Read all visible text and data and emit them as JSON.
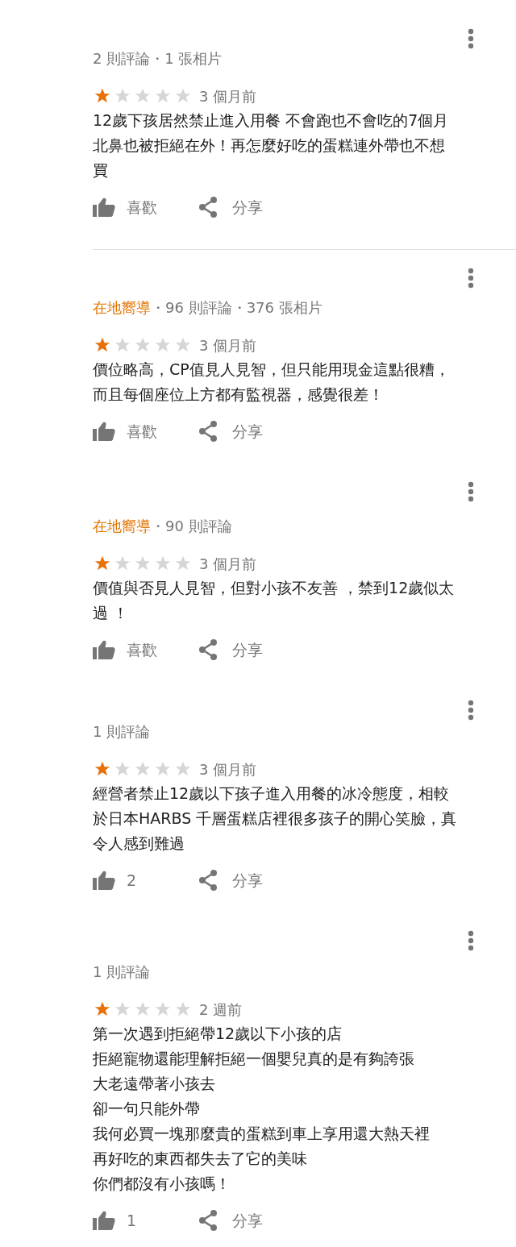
{
  "reviews": [
    {
      "stats": "2 則評論・1 張相片",
      "stars": 1,
      "time": "3 個月前",
      "lines": [
        "12歲下孩居然禁止進入用餐 不會跑也不會吃的7個月",
        "北鼻也被拒絕在外！再怎麼好吃的蛋糕連外帶也不想",
        "買"
      ],
      "like": "喜歡",
      "share": "分享",
      "divider_below": true
    },
    {
      "badge": "在地嚮導",
      "stats": "・96 則評論・376 張相片",
      "stars": 1,
      "time": "3 個月前",
      "lines": [
        "價位略高，CP值見人見智，但只能用現金這點很糟，",
        "而且每個座位上方都有監視器，感覺很差！"
      ],
      "like": "喜歡",
      "share": "分享",
      "divider_below": false
    },
    {
      "badge": "在地嚮導",
      "stats": "・90 則評論",
      "stars": 1,
      "time": "3 個月前",
      "lines": [
        "價值與否見人見智，但對小孩不友善 ，禁到12歲似太",
        "過 ！"
      ],
      "like": "喜歡",
      "share": "分享",
      "divider_below": false
    },
    {
      "stats": "1 則評論",
      "stars": 1,
      "time": "3 個月前",
      "lines": [
        "經營者禁止12歲以下孩子進入用餐的冰冷態度，相較",
        "於日本HARBS 千層蛋糕店裡很多孩子的開心笑臉，真",
        "令人感到難過"
      ],
      "like": "2",
      "share": "分享",
      "divider_below": false
    },
    {
      "stats": "1 則評論",
      "stars": 1,
      "time": "2 週前",
      "lines": [
        "第一次遇到拒絕帶12歲以下小孩的店",
        "拒絕寵物還能理解拒絕一個嬰兒真的是有夠誇張",
        "大老遠帶著小孩去",
        "卻一句只能外帶",
        "我何必買一塊那麼貴的蛋糕到車上享用還大熱天裡",
        "再好吃的東西都失去了它的美味",
        "你們都沒有小孩嗎！"
      ],
      "like": "1",
      "share": "分享",
      "divider_below": false
    }
  ]
}
